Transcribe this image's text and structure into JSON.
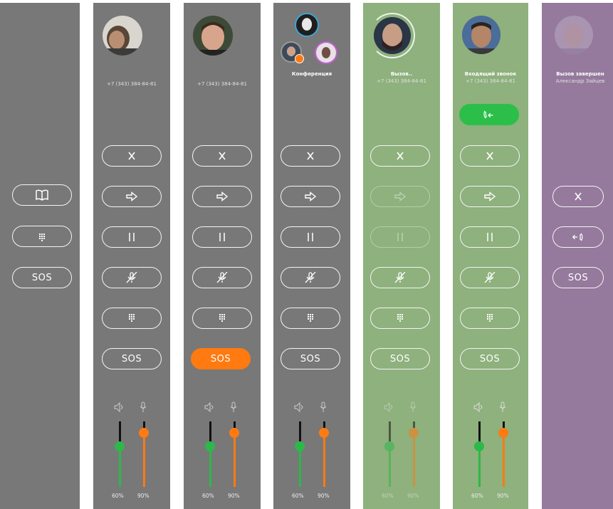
{
  "panels": [
    {
      "id": "idle",
      "bg": "#787878",
      "sos": "SOS"
    },
    {
      "id": "p1",
      "bg": "#787878",
      "phone": "+7 (343) 384-84-81",
      "sos": "SOS",
      "vol_speaker": "60%",
      "vol_mic": "90%"
    },
    {
      "id": "p2",
      "bg": "#787878",
      "phone": "+7 (343) 384-84-81",
      "sos": "SOS",
      "vol_speaker": "60%",
      "vol_mic": "90%"
    },
    {
      "id": "p3",
      "bg": "#787878",
      "name": "Конференция",
      "sos": "SOS",
      "vol_speaker": "60%",
      "vol_mic": "90%"
    },
    {
      "id": "p4",
      "bg": "#8eb17d",
      "name": "Вызов..",
      "phone": "+7 (343) 384-84-81",
      "sos": "SOS",
      "vol_speaker": "60%",
      "vol_mic": "90%"
    },
    {
      "id": "p5",
      "bg": "#8eb17d",
      "name": "Входящий звонок",
      "phone": "+7 (343) 384-84-81",
      "sos": "SOS",
      "vol_speaker": "60%",
      "vol_mic": "90%"
    },
    {
      "id": "p6",
      "bg": "#957a9d",
      "name": "Вызов завершен",
      "phone": "Александр Зайцев",
      "sos": "SOS"
    }
  ],
  "colors": {
    "accent_orange": "#ff7a11",
    "accent_green": "#2bbf4a",
    "slider_green": "#2db84a",
    "gray_bg": "#787878",
    "green_bg": "#8eb17d",
    "purple_bg": "#957a9d"
  },
  "levels": {
    "speaker": 0.6,
    "mic": 0.9
  }
}
